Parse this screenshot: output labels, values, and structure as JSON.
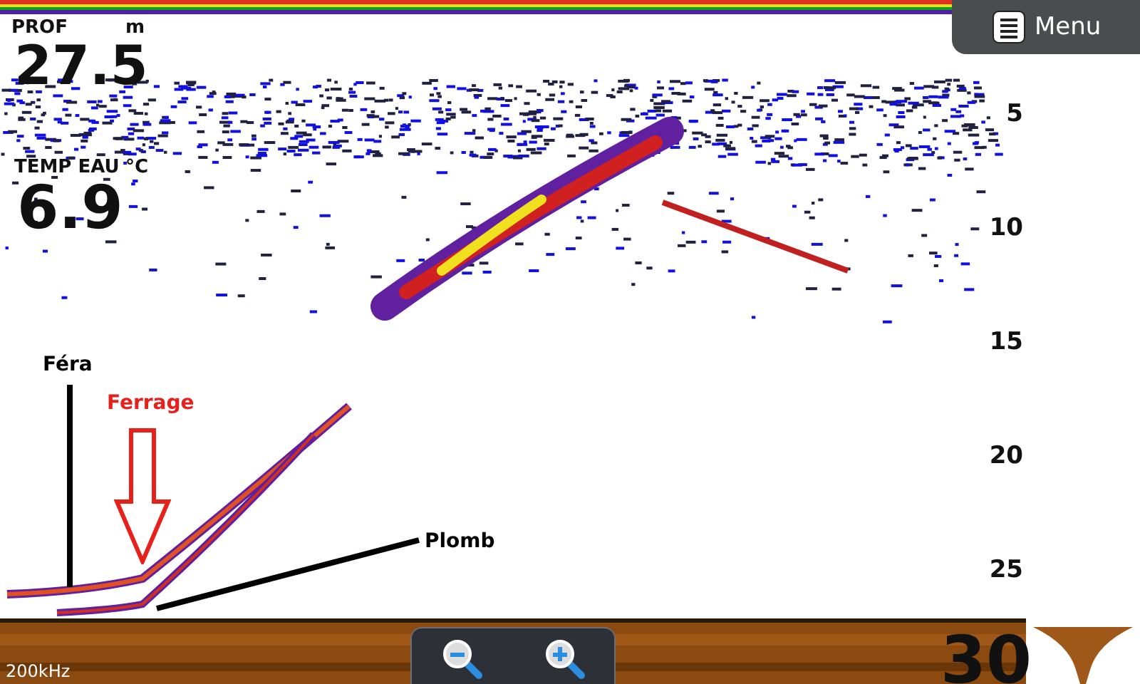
{
  "readouts": [
    {
      "label": "PROF",
      "unit": "m",
      "value": "27.5"
    },
    {
      "label": "TEMP EAU",
      "unit": "°C",
      "value": "6.9"
    }
  ],
  "menu_button": {
    "label": "Menu"
  },
  "depth_scale": [
    "5",
    "10",
    "15",
    "20",
    "25"
  ],
  "range": "30",
  "frequency": "200kHz",
  "annotations": [
    {
      "kind": "line",
      "label": "Féra",
      "color": "#000000"
    },
    {
      "kind": "arrow",
      "label": "Ferrage",
      "color": "#e8201c"
    },
    {
      "kind": "leader",
      "label": "Plomb",
      "color": "#000000"
    }
  ]
}
